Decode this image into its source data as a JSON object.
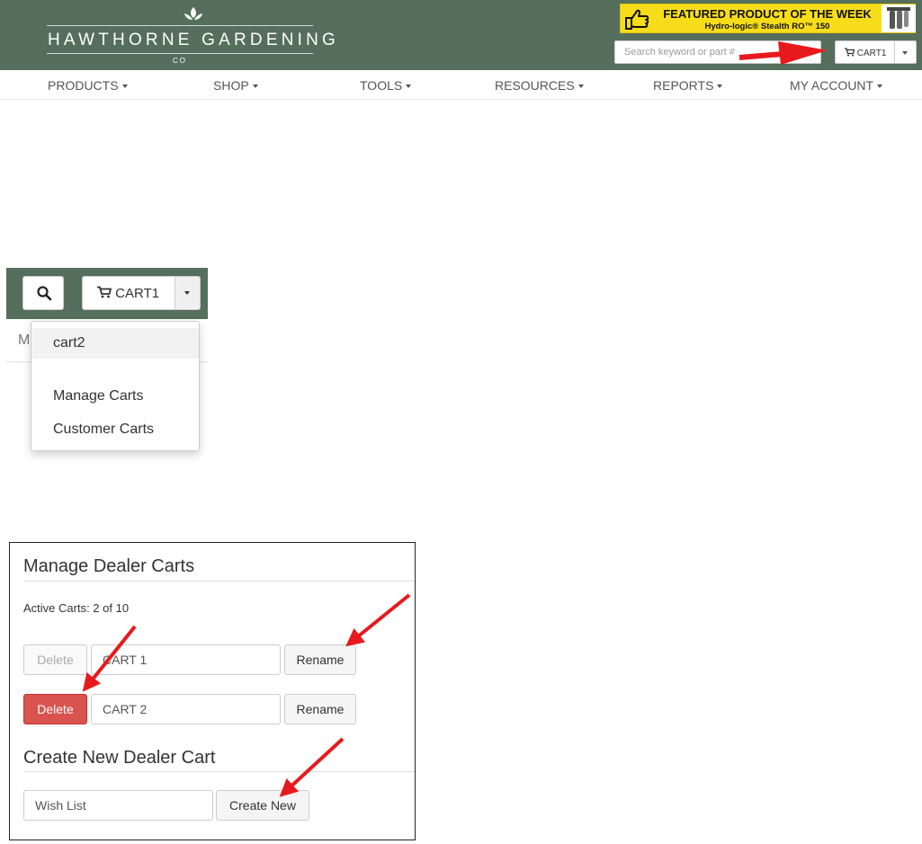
{
  "header": {
    "logo": {
      "name": "HAWTHORNE GARDENING",
      "suffix": "CO"
    },
    "banner": {
      "title": "FEATURED PRODUCT OF THE WEEK",
      "subtitle": "Hydro-logic® Stealth RO™ 150"
    },
    "search": {
      "placeholder": "Search keyword or part #"
    },
    "cart": {
      "label": "CART1"
    }
  },
  "nav": {
    "items": [
      {
        "label": "PRODUCTS"
      },
      {
        "label": "SHOP"
      },
      {
        "label": "TOOLS"
      },
      {
        "label": "RESOURCES"
      },
      {
        "label": "REPORTS"
      },
      {
        "label": "MY ACCOUNT"
      }
    ]
  },
  "zoom": {
    "cart_label": "CART1",
    "partial_nav_letter": "M",
    "dropdown": {
      "items": [
        {
          "label": "cart2"
        },
        {
          "label": "Manage Carts"
        },
        {
          "label": "Customer Carts"
        }
      ]
    }
  },
  "manage": {
    "title": "Manage Dealer Carts",
    "active_carts": "Active Carts: 2 of 10",
    "rows": [
      {
        "delete_label": "Delete",
        "cart_name": "CART 1",
        "rename_label": "Rename"
      },
      {
        "delete_label": "Delete",
        "cart_name": "CART 2",
        "rename_label": "Rename"
      }
    ],
    "create_title": "Create New Dealer Cart",
    "new_cart_value": "Wish List",
    "create_button": "Create New"
  },
  "colors": {
    "header_bg": "#566e5c",
    "banner_bg": "#f7dd19",
    "danger": "#d9534f",
    "arrow": "#e8191c"
  }
}
